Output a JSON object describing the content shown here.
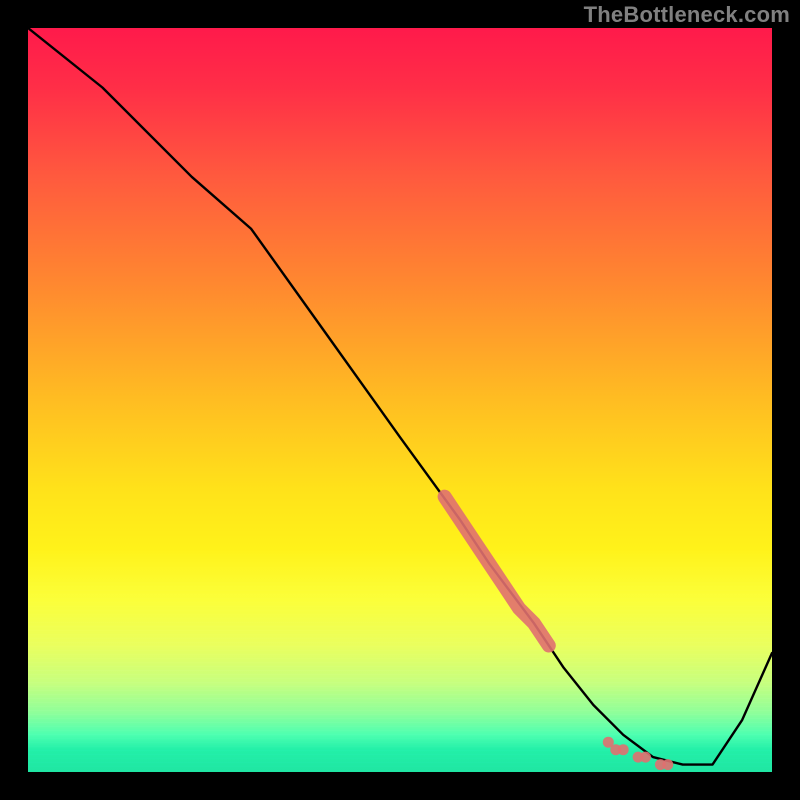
{
  "watermark": "TheBottleneck.com",
  "chart_data": {
    "type": "line",
    "title": "",
    "xlabel": "",
    "ylabel": "",
    "xlim": [
      0,
      100
    ],
    "ylim": [
      0,
      100
    ],
    "grid": false,
    "legend": false,
    "series": [
      {
        "name": "bottleneck-curve",
        "x": [
          0,
          10,
          22,
          30,
          40,
          50,
          58,
          62,
          68,
          72,
          76,
          80,
          84,
          88,
          92,
          96,
          100
        ],
        "y": [
          100,
          92,
          80,
          73,
          59,
          45,
          34,
          28,
          20,
          14,
          9,
          5,
          2,
          1,
          1,
          7,
          16
        ]
      }
    ],
    "highlight_segment": {
      "name": "critical-region",
      "color": "#e07070",
      "points": [
        {
          "x": 56,
          "y": 37
        },
        {
          "x": 58,
          "y": 34
        },
        {
          "x": 60,
          "y": 31
        },
        {
          "x": 62,
          "y": 28
        },
        {
          "x": 64,
          "y": 25
        },
        {
          "x": 66,
          "y": 22
        },
        {
          "x": 68,
          "y": 20
        },
        {
          "x": 70,
          "y": 17
        }
      ]
    },
    "highlight_cluster_low": {
      "name": "optimal-region",
      "color": "#e07070",
      "points": [
        {
          "x": 78,
          "y": 4
        },
        {
          "x": 79,
          "y": 3
        },
        {
          "x": 80,
          "y": 3
        },
        {
          "x": 82,
          "y": 2
        },
        {
          "x": 83,
          "y": 2
        },
        {
          "x": 85,
          "y": 1
        },
        {
          "x": 86,
          "y": 1
        }
      ]
    },
    "background": {
      "description": "vertical gradient red (top) → yellow (mid) → green band (bottom)"
    }
  }
}
